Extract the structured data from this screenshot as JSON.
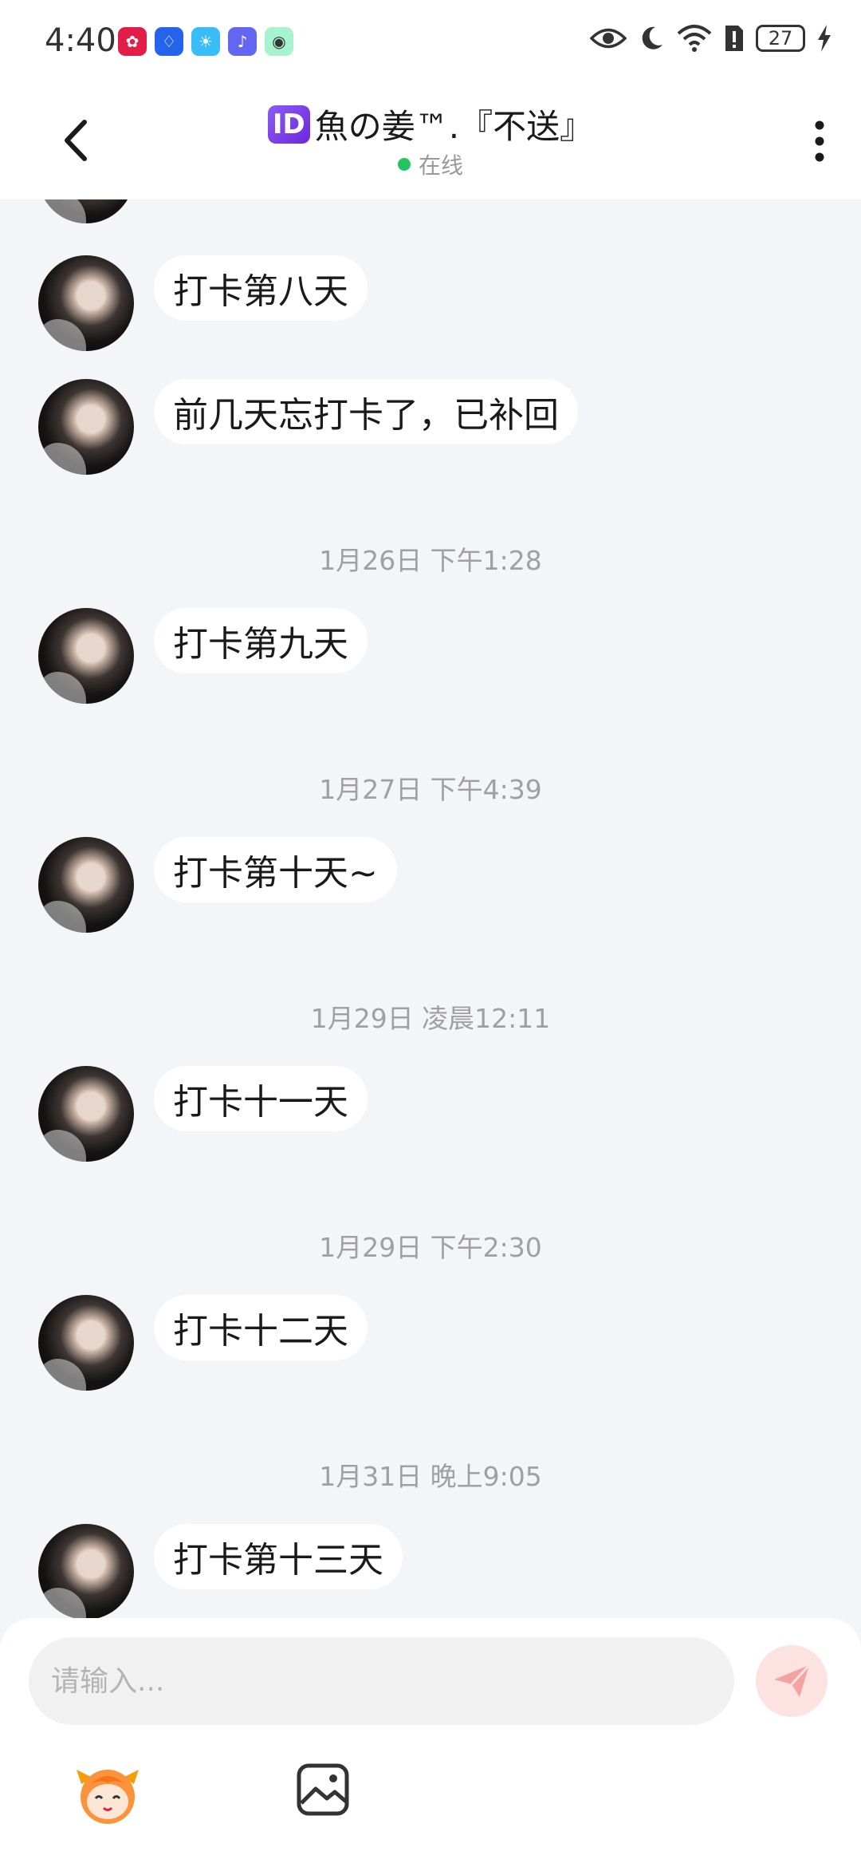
{
  "status_bar": {
    "time": "4:40",
    "battery": "27"
  },
  "header": {
    "id_badge": "ID",
    "title": "魚の姜™.『不送』",
    "status": "在线"
  },
  "messages": [
    {
      "text": "打卡第八天"
    },
    {
      "text": "前几天忘打卡了，已补回"
    },
    {
      "timestamp": "1月26日 下午1:28",
      "text": "打卡第九天"
    },
    {
      "timestamp": "1月27日 下午4:39",
      "text": "打卡第十天~"
    },
    {
      "timestamp": "1月29日 凌晨12:11",
      "text": "打卡十一天"
    },
    {
      "timestamp": "1月29日 下午2:30",
      "text": "打卡十二天"
    },
    {
      "timestamp": "1月31日 晚上9:05",
      "text": "打卡第十三天"
    }
  ],
  "composer": {
    "placeholder": "请输入..."
  },
  "colors": {
    "online": "#22c55e",
    "send_button_bg": "#fde2e2",
    "send_icon": "#f4a3a3",
    "badge": "#7c3aed"
  }
}
